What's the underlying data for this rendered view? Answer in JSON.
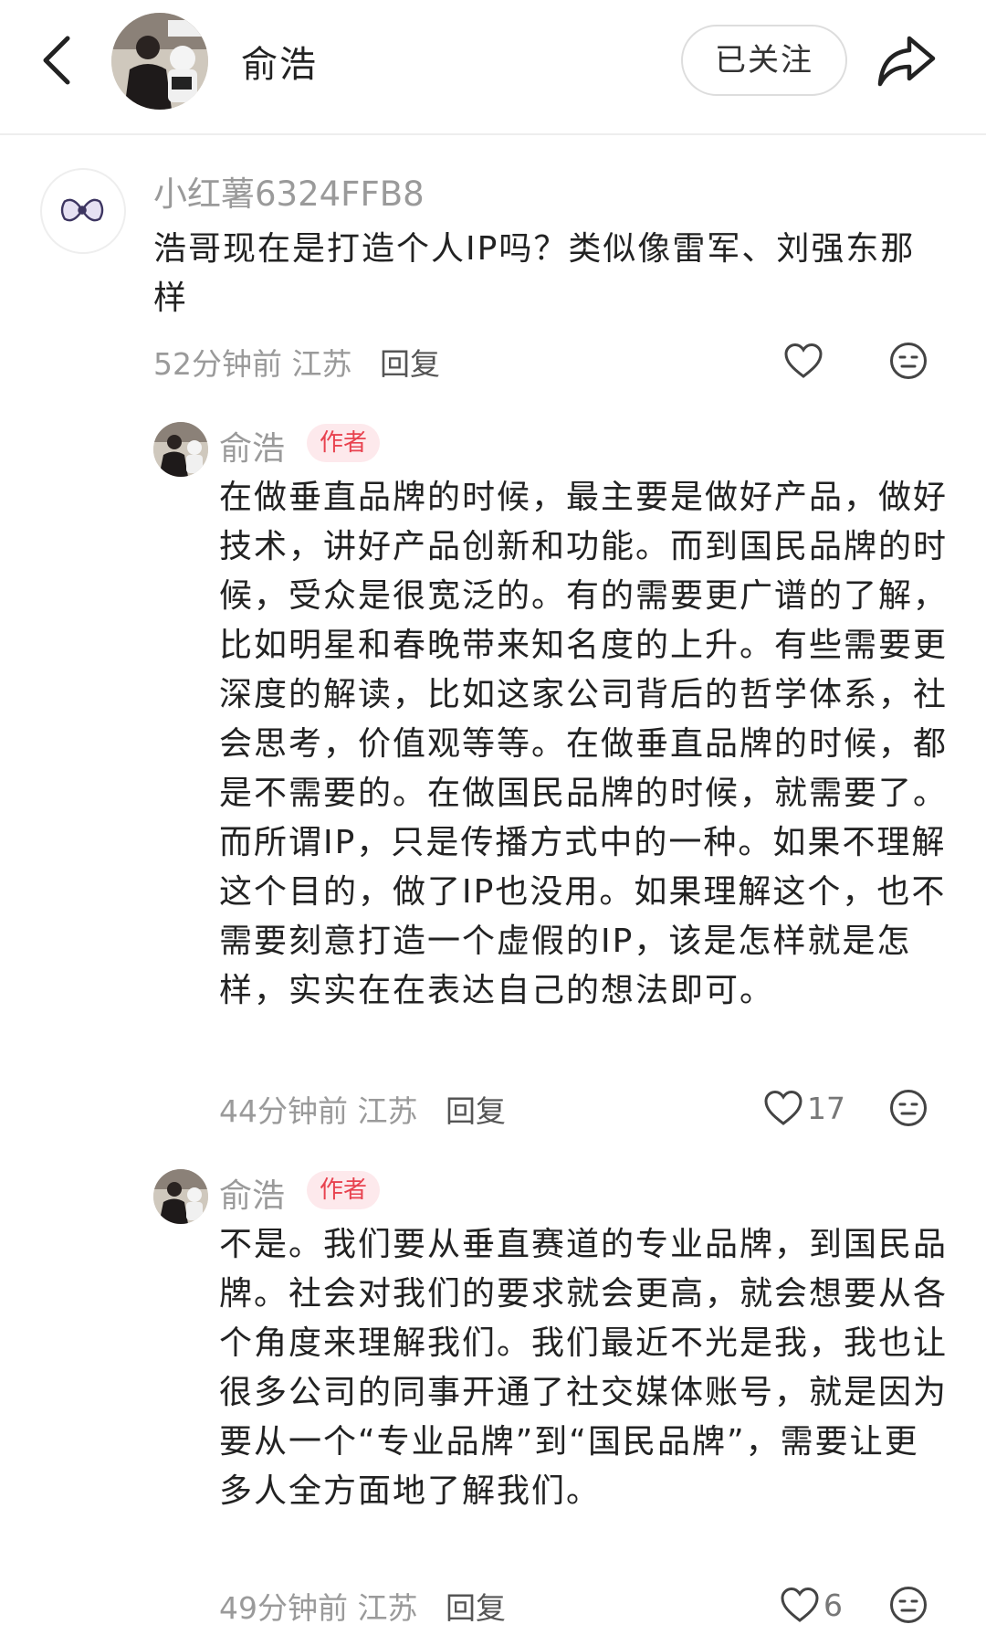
{
  "header": {
    "author_name": "俞浩",
    "follow_label": "已关注"
  },
  "comment": {
    "user_name": "小红薯6324FFB8",
    "text": "浩哥现在是打造个人IP吗？类似像雷军、刘强东那样",
    "time": "52分钟前",
    "location": "江苏",
    "reply_label": "回复",
    "likes": ""
  },
  "replies": [
    {
      "user_name": "俞浩",
      "badge": "作者",
      "text": "在做垂直品牌的时候，最主要是做好产品，做好技术，讲好产品创新和功能。而到国民品牌的时候，受众是很宽泛的。有的需要更广谱的了解，比如明星和春晚带来知名度的上升。有些需要更深度的解读，比如这家公司背后的哲学体系，社会思考，价值观等等。在做垂直品牌的时候，都是不需要的。在做国民品牌的时候，就需要了。而所谓IP，只是传播方式中的一种。如果不理解这个目的，做了IP也没用。如果理解这个，也不需要刻意打造一个虚假的IP，该是怎样就是怎样，实实在在表达自己的想法即可。",
      "time": "44分钟前",
      "location": "江苏",
      "reply_label": "回复",
      "likes": "17"
    },
    {
      "user_name": "俞浩",
      "badge": "作者",
      "text": "不是。我们要从垂直赛道的专业品牌，到国民品牌。社会对我们的要求就会更高，就会想要从各个角度来理解我们。我们最近不光是我，我也让很多公司的同事开通了社交媒体账号，就是因为要从一个“专业品牌”到“国民品牌”，需要让更多人全方面地了解我们。",
      "time": "49分钟前",
      "location": "江苏",
      "reply_label": "回复",
      "likes": "6"
    }
  ],
  "icons": {
    "back": "chevron-left-icon",
    "share": "share-arrow-icon",
    "like": "heart-outline-icon",
    "emoji": "neutral-face-icon"
  }
}
